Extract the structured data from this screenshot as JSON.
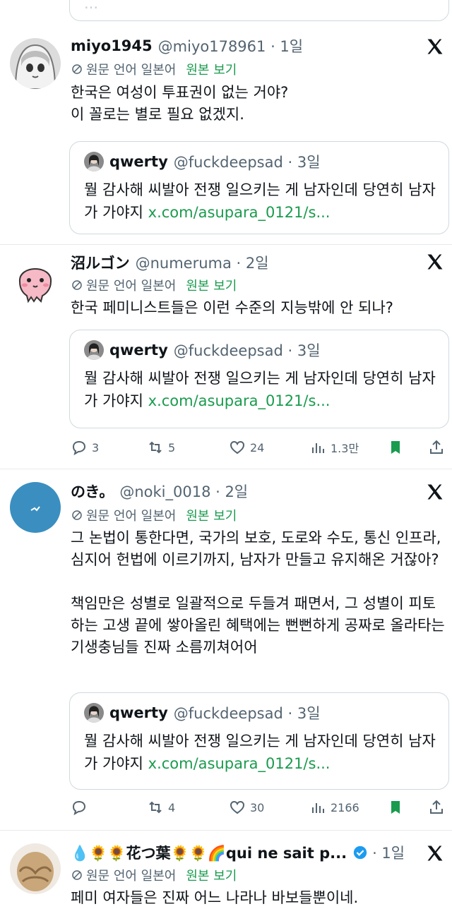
{
  "common": {
    "translate_label": "원문 언어 일본어",
    "show_original": "원본 보기"
  },
  "colors": {
    "accent_green": "#1a9b4e",
    "secondary_text": "#536471",
    "border": "#cfd9de"
  },
  "top_quote_fragment": "...",
  "posts": [
    {
      "name": "miyo1945",
      "handle": "@miyo178961 · 1일",
      "text": "한국은 여성이 투표권이 없는 거야?\n이 꼴로는 별로 필요 없겠지.",
      "quote": {
        "name": "qwerty",
        "handle": "@fuckdeepsad · 3일",
        "text": "뭘 감사해 씨발아 전쟁 일으키는 게 남자인데 당연히 남자가 가야지 ",
        "link": "x.com/asupara_0121/s..."
      }
    },
    {
      "name": "沼ルゴン",
      "handle": "@numeruma · 2일",
      "text": "한국 페미니스트들은 이런 수준의 지능밖에 안 되나?",
      "quote": {
        "name": "qwerty",
        "handle": "@fuckdeepsad · 3일",
        "text": "뭘 감사해 씨발아 전쟁 일으키는 게 남자인데 당연히 남자가 가야지 ",
        "link": "x.com/asupara_0121/s..."
      },
      "stats": {
        "replies": "3",
        "reposts": "5",
        "likes": "24",
        "views": "1.3만"
      }
    },
    {
      "name": "のき。",
      "handle": "@noki_0018 · 2일",
      "text": "그 논법이 통한다면, 국가의 보호, 도로와 수도, 통신 인프라, 심지어 헌법에 이르기까지, 남자가 만들고 유지해온 거잖아?\n\n책임만은 성별로 일괄적으로 두들겨 패면서, 그 성별이 피토하는 고생 끝에 쌓아올린 혜택에는 뻔뻔하게 공짜로 올라타는 기생충님들 진짜 소름끼쳐어어",
      "quote": {
        "name": "qwerty",
        "handle": "@fuckdeepsad · 3일",
        "text": "뭘 감사해 씨발아 전쟁 일으키는 게 남자인데 당연히 남자가 가야지 ",
        "link": "x.com/asupara_0121/s..."
      },
      "stats": {
        "replies": "",
        "reposts": "4",
        "likes": "30",
        "views": "2166"
      }
    },
    {
      "name": "💧🌻🌻花つ葉🌻🌻🌈qui ne sait p...",
      "handle": "· 1일",
      "text": "페미 여자들은 진짜 어느 나라나 바보들뿐이네."
    }
  ]
}
